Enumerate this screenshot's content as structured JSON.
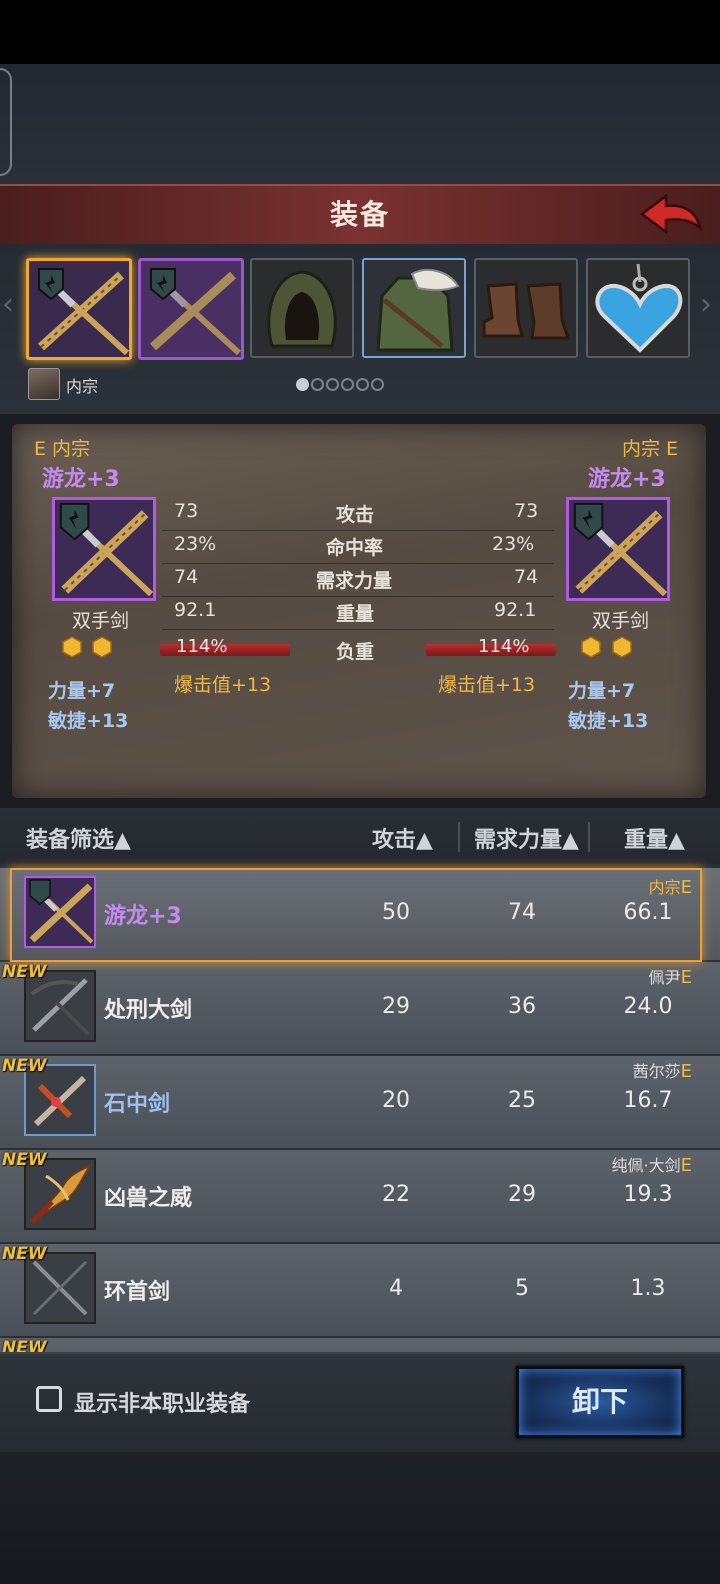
{
  "header": {
    "title": "装备"
  },
  "slots": [
    {
      "name": "weapon-slot-1",
      "state": "selected"
    },
    {
      "name": "weapon-slot-2",
      "state": "purple"
    },
    {
      "name": "hood-slot",
      "state": "normal"
    },
    {
      "name": "armor-slot",
      "state": "blue"
    },
    {
      "name": "boots-slot",
      "state": "normal"
    },
    {
      "name": "amulet-slot",
      "state": "normal"
    }
  ],
  "character": {
    "name": "内宗"
  },
  "pagination": {
    "total": 6,
    "active": 1
  },
  "compare": {
    "left": {
      "owner_grade": "E 内宗",
      "item_name": "游龙+3",
      "type": "双手剑",
      "attrs": [
        "力量+7",
        "敏捷+13"
      ],
      "stats": [
        "73",
        "23%",
        "74",
        "92.1"
      ],
      "load": "114%",
      "crit": "爆击值+13"
    },
    "right": {
      "owner_grade": "内宗 E",
      "item_name": "游龙+3",
      "type": "双手剑",
      "attrs": [
        "力量+7",
        "敏捷+13"
      ],
      "stats": [
        "73",
        "23%",
        "74",
        "92.1"
      ],
      "load": "114%",
      "crit": "爆击值+13"
    },
    "labels": [
      "攻击",
      "命中率",
      "需求力量",
      "重量",
      "负重"
    ]
  },
  "list_header": {
    "filter": "装备筛选▲",
    "attack": "攻击▲",
    "str_req": "需求力量▲",
    "weight": "重量▲"
  },
  "list": [
    {
      "name": "游龙+3",
      "attack": "50",
      "str": "74",
      "weight": "66.1",
      "owner": "内宗",
      "grade": "E",
      "new": "",
      "color": "purple"
    },
    {
      "name": "处刑大剑",
      "attack": "29",
      "str": "36",
      "weight": "24.0",
      "owner": "佩尹",
      "grade": "E",
      "new": "NEW",
      "color": "normal"
    },
    {
      "name": "石中剑",
      "attack": "20",
      "str": "25",
      "weight": "16.7",
      "owner": "茜尔莎",
      "grade": "E",
      "new": "NEW",
      "color": "blue"
    },
    {
      "name": "凶兽之威",
      "attack": "22",
      "str": "29",
      "weight": "19.3",
      "owner": "纯佩·大剑",
      "grade": "E",
      "new": "NEW",
      "color": "normal"
    },
    {
      "name": "环首剑",
      "attack": "4",
      "str": "5",
      "weight": "1.3",
      "owner": "",
      "grade": "",
      "new": "NEW",
      "color": "normal"
    },
    {
      "name": "",
      "attack": "",
      "str": "",
      "weight": "",
      "owner": "",
      "grade": "",
      "new": "NEW",
      "color": "normal"
    }
  ],
  "footer": {
    "checkbox_label": "显示非本职业装备",
    "unequip": "卸下"
  }
}
